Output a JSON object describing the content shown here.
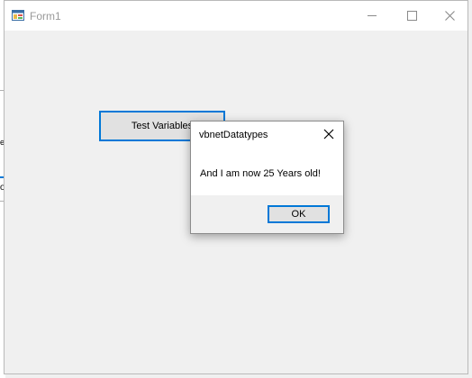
{
  "window": {
    "title": "Form1"
  },
  "form": {
    "test_button_label": "Test Variables"
  },
  "message_box": {
    "title": "vbnetDatatypes",
    "message": "And I am now 25 Years old!",
    "ok_label": "OK"
  },
  "background_window": {
    "mark1": "e",
    "mark2": "o"
  },
  "colors": {
    "accent": "#0078d7",
    "titlebar": "#ffffff",
    "surface": "#f0f0f0",
    "button_face": "#e1e1e1"
  },
  "icons": {
    "app": "winforms-app-icon",
    "minimize": "minimize-icon",
    "maximize": "maximize-icon",
    "close": "close-icon"
  }
}
